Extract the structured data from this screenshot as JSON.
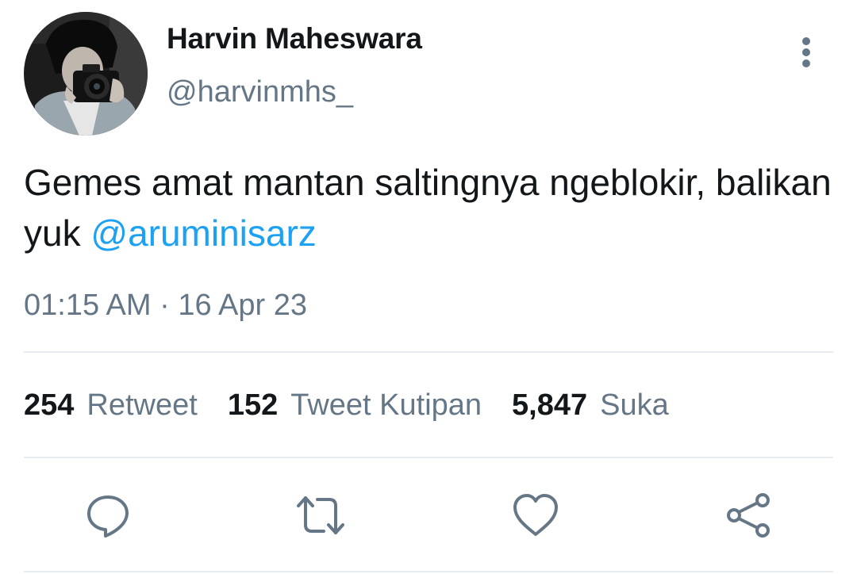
{
  "tweet": {
    "author": {
      "display_name": "Harvin Maheswara",
      "handle": "@harvinmhs_"
    },
    "text": "Gemes amat mantan saltingnya ngeblokir, balikan yuk ",
    "mention": "@aruminisarz",
    "timestamp": "01:15 AM · 16 Apr 23"
  },
  "stats": {
    "retweets": {
      "count": "254",
      "label": "Retweet"
    },
    "quotes": {
      "count": "152",
      "label": "Tweet Kutipan"
    },
    "likes": {
      "count": "5,847",
      "label": "Suka"
    }
  },
  "actions": {
    "reply": "reply-icon",
    "retweet": "retweet-icon",
    "like": "heart-icon",
    "share": "share-icon",
    "more": "more-vertical-icon"
  },
  "colors": {
    "text": "#14171a",
    "secondary": "#657786",
    "link": "#1da1f2",
    "divider": "#e6ecf0"
  }
}
